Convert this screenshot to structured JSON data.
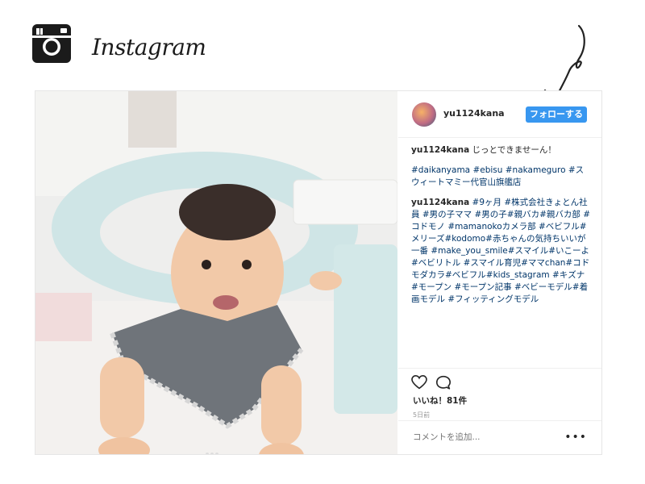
{
  "header": {
    "wordmark": "Instagram",
    "icon": "instagram-camera-icon"
  },
  "post": {
    "username": "yu1124kana",
    "follow_label": "フォローする",
    "caption_user": "yu1124kana",
    "caption_text": " じっとできませーん！",
    "hashtags_1": "#daikanyama #ebisu #nakameguro #スウィートマミー代官山旗艦店",
    "comment_user": "yu1124kana",
    "comment_text": " #9ヶ月 #株式会社きょとん社員 #男の子ママ #男の子#親バカ#親バカ部 #コドモノ #mamanokoカメラ部 #ベビフル#メリーズ#kodomo#赤ちゃんの気持ちいいが一番 #make_you_smile#スマイル#いこーよ#ベビリトル #スマイル育児#ママchan#コドモダカラ#ベビフル#kids_stagram #キズナ #モープン #モープン記事 #ベビーモデル#着画モデル #フィッティングモデル",
    "likes": "いいね！81件",
    "date": "5日前",
    "comment_placeholder": "コメントを追加...",
    "more_label": "•••"
  },
  "icons": {
    "like": "heart-icon",
    "comment": "comment-icon",
    "more": "more-options-icon"
  },
  "colors": {
    "follow_button": "#3897f0",
    "hashtag": "#003569",
    "border": "#efefef"
  }
}
